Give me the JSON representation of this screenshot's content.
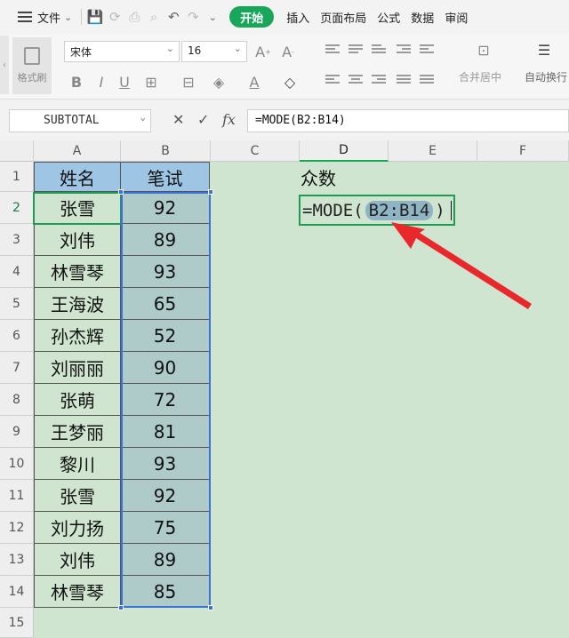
{
  "menubar": {
    "file_label": "文件",
    "tabs": [
      "开始",
      "插入",
      "页面布局",
      "公式",
      "数据",
      "审阅"
    ]
  },
  "ribbon": {
    "format_painter": "格式刷",
    "font": "宋体",
    "size": "16",
    "merge": "合并居中",
    "wrap": "自动换行"
  },
  "formula_bar": {
    "name_box": "SUBTOTAL",
    "formula": "=MODE(B2:B14)"
  },
  "sheet": {
    "columns": [
      "A",
      "B",
      "C",
      "D",
      "E",
      "F"
    ],
    "row_numbers": [
      "1",
      "2",
      "3",
      "4",
      "5",
      "6",
      "7",
      "8",
      "9",
      "10",
      "11",
      "12",
      "13",
      "14",
      "15"
    ],
    "header": {
      "name": "姓名",
      "score": "笔试"
    },
    "rows": [
      {
        "name": "张雪",
        "score": "92"
      },
      {
        "name": "刘伟",
        "score": "89"
      },
      {
        "name": "林雪琴",
        "score": "93"
      },
      {
        "name": "王海波",
        "score": "65"
      },
      {
        "name": "孙杰辉",
        "score": "52"
      },
      {
        "name": "刘丽丽",
        "score": "90"
      },
      {
        "name": "张萌",
        "score": "72"
      },
      {
        "name": "王梦丽",
        "score": "81"
      },
      {
        "name": "黎川",
        "score": "93"
      },
      {
        "name": "张雪",
        "score": "92"
      },
      {
        "name": "刘力扬",
        "score": "75"
      },
      {
        "name": "刘伟",
        "score": "89"
      },
      {
        "name": "林雪琴",
        "score": "85"
      }
    ],
    "d1": "众数",
    "edit": {
      "prefix": "=MODE(",
      "range": "B2:B14",
      "suffix": ")"
    }
  },
  "colors": {
    "accent": "#19a55a",
    "selection": "#3a72d8",
    "arrow": "#e8282b"
  }
}
